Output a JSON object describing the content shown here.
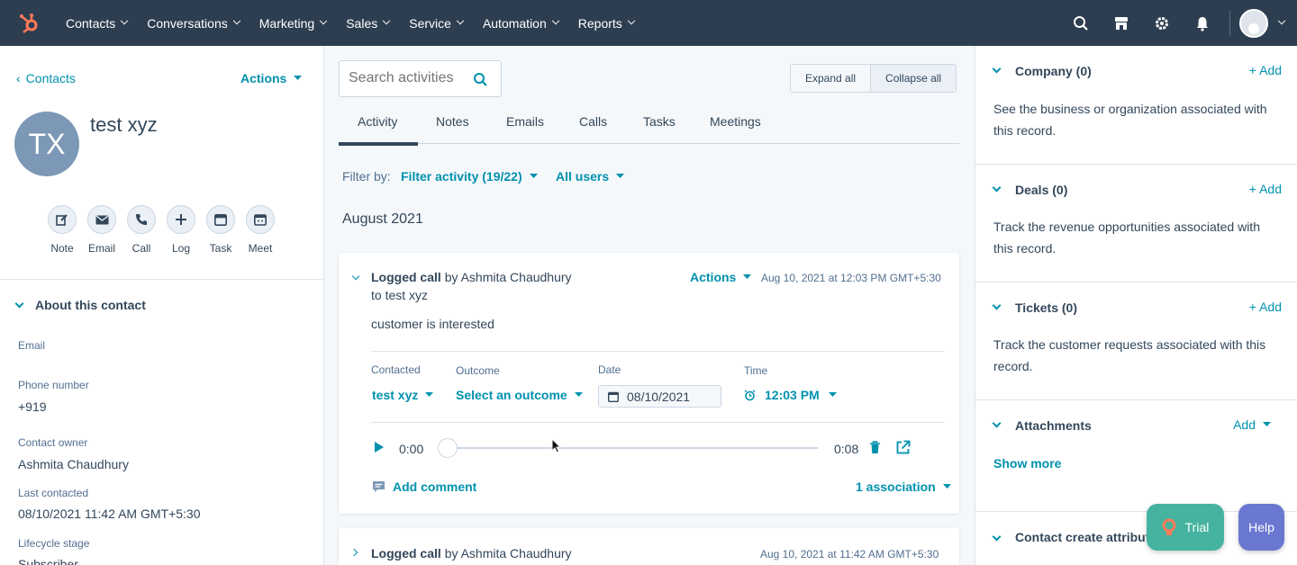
{
  "colors": {
    "nav_bg": "#2d3e50",
    "link": "#0091ae",
    "brand": "#ff7a59",
    "trial_bg": "#45b39f",
    "help_bg": "#6a78d1"
  },
  "nav": {
    "items": [
      "Contacts",
      "Conversations",
      "Marketing",
      "Sales",
      "Service",
      "Automation",
      "Reports"
    ],
    "icons": [
      "search-icon",
      "marketplace-icon",
      "settings-icon",
      "notifications-icon",
      "avatar"
    ]
  },
  "left": {
    "back_label": "Contacts",
    "actions_label": "Actions",
    "avatar_initials": "TX",
    "contact_name": "test xyz",
    "quick_actions": [
      "Note",
      "Email",
      "Call",
      "Log",
      "Task",
      "Meet"
    ],
    "about_title": "About this contact",
    "props": {
      "email_label": "Email",
      "phone_label": "Phone number",
      "phone_value": "+919",
      "owner_label": "Contact owner",
      "owner_value": "Ashmita Chaudhury",
      "last_contacted_label": "Last contacted",
      "last_contacted_value": "08/10/2021 11:42 AM GMT+5:30",
      "lifecycle_label": "Lifecycle stage",
      "lifecycle_value": "Subscriber"
    }
  },
  "mid": {
    "search_placeholder": "Search activities",
    "expand_all": "Expand all",
    "collapse_all": "Collapse all",
    "tabs": [
      "Activity",
      "Notes",
      "Emails",
      "Calls",
      "Tasks",
      "Meetings"
    ],
    "active_tab": "Activity",
    "filter_by_label": "Filter by:",
    "filter_activity": "Filter activity (19/22)",
    "all_users": "All users",
    "month_heading": "August 2021",
    "card1": {
      "type": "Logged call",
      "by_text": "by Ashmita Chaudhury",
      "to_text": "to test xyz",
      "actions_label": "Actions",
      "timestamp": "Aug 10, 2021 at 12:03 PM GMT+5:30",
      "body": "customer is interested",
      "contacted_label": "Contacted",
      "contacted_value": "test xyz",
      "outcome_label": "Outcome",
      "outcome_value": "Select an outcome",
      "date_label": "Date",
      "date_value": "08/10/2021",
      "time_label": "Time",
      "time_value": "12:03 PM",
      "audio_current": "0:00",
      "audio_total": "0:08",
      "audio_progress": 0,
      "add_comment": "Add comment",
      "association": "1 association"
    },
    "card2": {
      "type": "Logged call",
      "by_text": "by Ashmita Chaudhury",
      "timestamp": "Aug 10, 2021 at 11:42 AM GMT+5:30"
    }
  },
  "right": {
    "sections": [
      {
        "title": "Company (0)",
        "action": "+ Add",
        "text": "See the business or organization associated with this record."
      },
      {
        "title": "Deals (0)",
        "action": "+ Add",
        "text": "Track the revenue opportunities associated with this record."
      },
      {
        "title": "Tickets (0)",
        "action": "+ Add",
        "text": "Track the customer requests associated with this record."
      },
      {
        "title": "Attachments",
        "action": "Add",
        "text": ""
      }
    ],
    "show_more": "Show more",
    "last_section_title": "Contact create attributi"
  },
  "floating": {
    "trial": "Trial",
    "help": "Help"
  }
}
